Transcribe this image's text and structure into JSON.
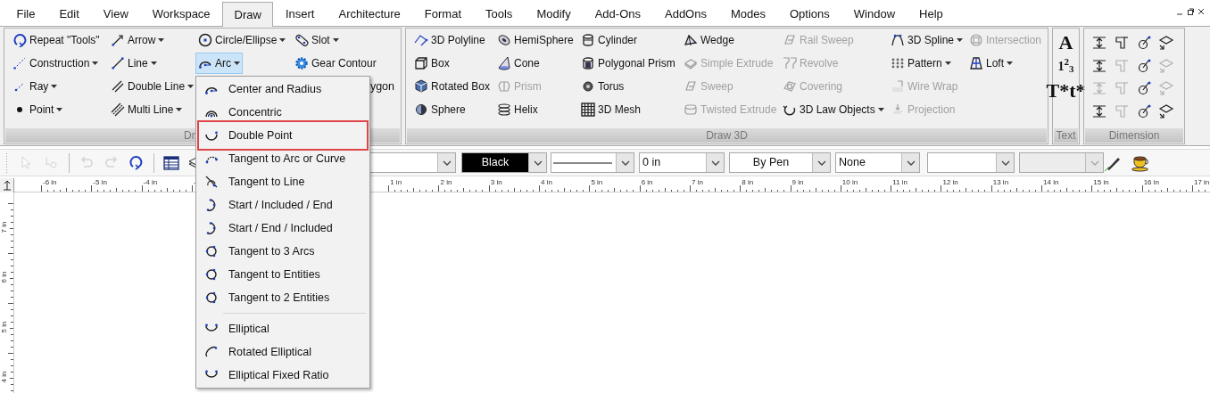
{
  "menu_bar": {
    "items": [
      {
        "label": "File",
        "selected": false
      },
      {
        "label": "Edit",
        "selected": false
      },
      {
        "label": "View",
        "selected": false
      },
      {
        "label": "Workspace",
        "selected": false
      },
      {
        "label": "Draw",
        "selected": true
      },
      {
        "label": "Insert",
        "selected": false
      },
      {
        "label": "Architecture",
        "selected": false
      },
      {
        "label": "Format",
        "selected": false
      },
      {
        "label": "Tools",
        "selected": false
      },
      {
        "label": "Modify",
        "selected": false
      },
      {
        "label": "Add-Ons",
        "selected": false
      },
      {
        "label": "AddOns",
        "selected": false
      },
      {
        "label": "Modes",
        "selected": false
      },
      {
        "label": "Options",
        "selected": false
      },
      {
        "label": "Window",
        "selected": false
      },
      {
        "label": "Help",
        "selected": false
      }
    ]
  },
  "ribbon": {
    "panels": [
      {
        "kind": "buttons",
        "caption": "Dr",
        "clipped_label": "ygon",
        "columns": [
          [
            {
              "label": "Repeat \"Tools\"",
              "dropdown": false,
              "disabled": false,
              "selected": false
            },
            {
              "label": "Construction",
              "dropdown": true,
              "disabled": false,
              "selected": false
            },
            {
              "label": "Ray",
              "dropdown": true,
              "disabled": false,
              "selected": false
            },
            {
              "label": "Point",
              "dropdown": true,
              "disabled": false,
              "selected": false
            }
          ],
          [
            {
              "label": "Arrow",
              "dropdown": true,
              "disabled": false,
              "selected": false
            },
            {
              "label": "Line",
              "dropdown": true,
              "disabled": false,
              "selected": false
            },
            {
              "label": "Double Line",
              "dropdown": true,
              "disabled": false,
              "selected": false
            },
            {
              "label": "Multi Line",
              "dropdown": true,
              "disabled": false,
              "selected": false
            }
          ],
          [
            {
              "label": "Circle/Ellipse",
              "dropdown": true,
              "disabled": false,
              "selected": false
            },
            {
              "label": "Arc",
              "dropdown": true,
              "disabled": false,
              "selected": true
            }
          ],
          [
            {
              "label": "Slot",
              "dropdown": true,
              "disabled": false,
              "selected": false
            },
            {
              "label": "Gear Contour",
              "dropdown": false,
              "disabled": false,
              "selected": false
            }
          ]
        ]
      },
      {
        "kind": "buttons",
        "caption": "Draw 3D",
        "columns": [
          [
            {
              "label": "3D Polyline",
              "dropdown": false,
              "disabled": false,
              "selected": false
            },
            {
              "label": "Box",
              "dropdown": false,
              "disabled": false,
              "selected": false
            },
            {
              "label": "Rotated Box",
              "dropdown": false,
              "disabled": false,
              "selected": false
            },
            {
              "label": "Sphere",
              "dropdown": false,
              "disabled": false,
              "selected": false
            }
          ],
          [
            {
              "label": "HemiSphere",
              "dropdown": false,
              "disabled": false,
              "selected": false
            },
            {
              "label": "Cone",
              "dropdown": false,
              "disabled": false,
              "selected": false
            },
            {
              "label": "Prism",
              "dropdown": false,
              "disabled": true,
              "selected": false
            },
            {
              "label": "Helix",
              "dropdown": false,
              "disabled": false,
              "selected": false
            }
          ],
          [
            {
              "label": "Cylinder",
              "dropdown": false,
              "disabled": false,
              "selected": false
            },
            {
              "label": "Polygonal Prism",
              "dropdown": false,
              "disabled": false,
              "selected": false
            },
            {
              "label": "Torus",
              "dropdown": false,
              "disabled": false,
              "selected": false
            },
            {
              "label": "3D Mesh",
              "dropdown": false,
              "disabled": false,
              "selected": false
            }
          ],
          [
            {
              "label": "Wedge",
              "dropdown": false,
              "disabled": false,
              "selected": false
            },
            {
              "label": "Simple Extrude",
              "dropdown": false,
              "disabled": true,
              "selected": false
            },
            {
              "label": "Sweep",
              "dropdown": false,
              "disabled": true,
              "selected": false
            },
            {
              "label": "Twisted Extrude",
              "dropdown": false,
              "disabled": true,
              "selected": false
            }
          ],
          [
            {
              "label": "Rail Sweep",
              "dropdown": false,
              "disabled": true,
              "selected": false
            },
            {
              "label": "Revolve",
              "dropdown": false,
              "disabled": true,
              "selected": false
            },
            {
              "label": "Covering",
              "dropdown": false,
              "disabled": true,
              "selected": false
            },
            {
              "label": "3D Law Objects",
              "dropdown": true,
              "disabled": false,
              "selected": false
            }
          ],
          [
            {
              "label": "3D Spline",
              "dropdown": true,
              "disabled": false,
              "selected": false
            },
            {
              "label": "Pattern",
              "dropdown": true,
              "disabled": false,
              "selected": false
            },
            {
              "label": "Wire Wrap",
              "dropdown": false,
              "disabled": true,
              "selected": false
            },
            {
              "label": "Projection",
              "dropdown": false,
              "disabled": true,
              "selected": false
            }
          ],
          [
            {
              "label": "Intersection",
              "dropdown": false,
              "disabled": true,
              "selected": false
            },
            {
              "label": "Loft",
              "dropdown": true,
              "disabled": false,
              "selected": false
            }
          ]
        ]
      },
      {
        "kind": "glyphs",
        "caption": "Text",
        "glyphs": [
          "A",
          "1$^{2}$$_{3}$",
          "T*t*"
        ]
      },
      {
        "kind": "tools",
        "caption": "Dimension",
        "tools": [
          {
            "disabled": false
          },
          {
            "disabled": false
          },
          {
            "disabled": false
          },
          {
            "disabled": false
          },
          {
            "disabled": false
          },
          {
            "disabled": true
          },
          {
            "disabled": false
          },
          {
            "disabled": true
          },
          {
            "disabled": true
          },
          {
            "disabled": true
          },
          {
            "disabled": false
          },
          {
            "disabled": true
          },
          {
            "disabled": false
          },
          {
            "disabled": true
          },
          {
            "disabled": false
          },
          {
            "disabled": false
          }
        ]
      }
    ]
  },
  "toolbar": {
    "tools": [
      {
        "disabled": true
      },
      {
        "disabled": true
      },
      {
        "disabled": true
      },
      {
        "disabled": true
      },
      {
        "disabled": false
      },
      {
        "disabled": false
      },
      {
        "disabled": false
      }
    ],
    "combos": [
      {
        "kind": "blank",
        "disabled": false
      },
      {
        "kind": "color",
        "value": "Black",
        "color": "#000000"
      },
      {
        "kind": "linestyle"
      },
      {
        "kind": "text",
        "value": "0 in"
      },
      {
        "kind": "centered",
        "value": "By Pen"
      },
      {
        "kind": "text",
        "value": "None"
      },
      {
        "kind": "blank",
        "disabled": false
      },
      {
        "kind": "blank",
        "disabled": true
      }
    ]
  },
  "horizontal_ruler": {
    "left": [
      "-6 in",
      "-5 in",
      "-4 in",
      "-"
    ],
    "right": [
      "1 in",
      "2 in",
      "3 in",
      "4 in",
      "5 in",
      "6 in",
      "7 in",
      "8 in",
      "9 in",
      "10 in",
      "11 in",
      "12 in",
      "13 in",
      "14 in",
      "15 in",
      "16 in",
      "17 in"
    ]
  },
  "vertical_ruler": {
    "labels": [
      "7 in",
      "6 in",
      "5 in",
      "4 in"
    ]
  },
  "arc_menu": {
    "items": [
      {
        "kind": "item",
        "label": "Center and Radius",
        "selected": false
      },
      {
        "kind": "item",
        "label": "Concentric",
        "selected": false
      },
      {
        "kind": "item",
        "label": "Double Point",
        "selected": true
      },
      {
        "kind": "item",
        "label": "Tangent to Arc or Curve",
        "selected": false
      },
      {
        "kind": "item",
        "label": "Tangent to Line",
        "selected": false
      },
      {
        "kind": "item",
        "label": "Start / Included / End",
        "selected": false
      },
      {
        "kind": "item",
        "label": "Start / End / Included",
        "selected": false
      },
      {
        "kind": "item",
        "label": "Tangent to 3 Arcs",
        "selected": false
      },
      {
        "kind": "item",
        "label": "Tangent to Entities",
        "selected": false
      },
      {
        "kind": "item",
        "label": "Tangent to 2 Entities",
        "selected": false
      },
      {
        "kind": "separator"
      },
      {
        "kind": "item",
        "label": "Elliptical",
        "selected": false
      },
      {
        "kind": "item",
        "label": "Rotated Elliptical",
        "selected": false
      },
      {
        "kind": "item",
        "label": "Elliptical Fixed Ratio",
        "selected": false
      }
    ]
  }
}
